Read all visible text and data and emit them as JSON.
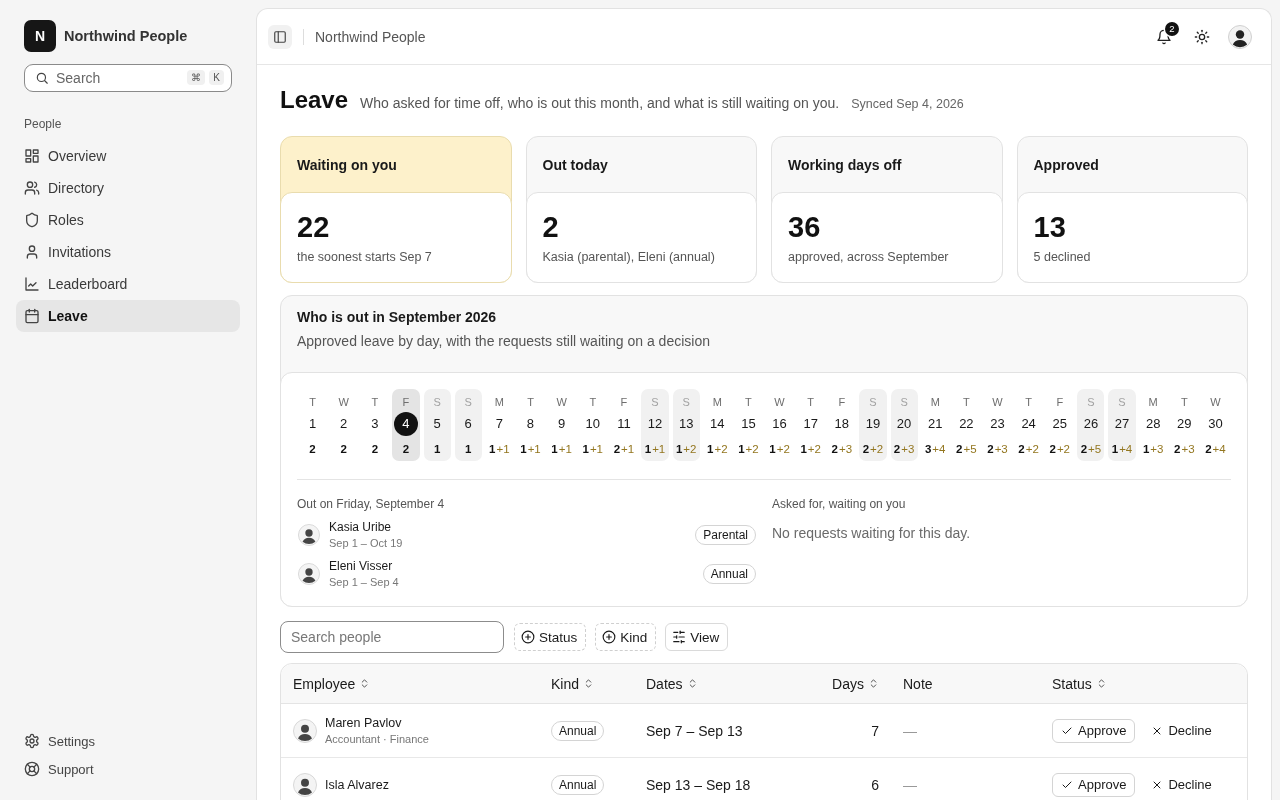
{
  "sidebar": {
    "brand": {
      "initial": "N",
      "name": "Northwind People"
    },
    "search": {
      "placeholder": "Search",
      "shortcut": [
        "⌘",
        "K"
      ]
    },
    "section": "People",
    "items": [
      {
        "label": "Overview",
        "selected": false
      },
      {
        "label": "Directory",
        "selected": false
      },
      {
        "label": "Roles",
        "selected": false
      },
      {
        "label": "Invitations",
        "selected": false
      },
      {
        "label": "Leaderboard",
        "selected": false
      },
      {
        "label": "Leave",
        "selected": true
      }
    ],
    "footer_items": [
      {
        "label": "Settings"
      },
      {
        "label": "Support"
      }
    ]
  },
  "header": {
    "breadcrumb": "Northwind People",
    "notification_count": "2"
  },
  "page": {
    "title": "Leave",
    "subtitle": "Who asked for time off, who is out this month, and what is still waiting on you.",
    "synced": "Synced Sep 4, 2026"
  },
  "stats": [
    {
      "title": "Waiting on you",
      "value": "22",
      "caption": "the soonest starts Sep 7",
      "highlight": true
    },
    {
      "title": "Out today",
      "value": "2",
      "caption": "Kasia (parental), Eleni (annual)",
      "highlight": false
    },
    {
      "title": "Working days off",
      "value": "36",
      "caption": "approved, across September",
      "highlight": false
    },
    {
      "title": "Approved",
      "value": "13",
      "caption": "5 declined",
      "highlight": false
    }
  ],
  "calendar": {
    "title": "Who is out in September 2026",
    "subtitle": "Approved leave by day, with the requests still waiting on a decision",
    "days": [
      {
        "weekday": "T",
        "date": "1",
        "out": "2",
        "weekend": false,
        "selected": false
      },
      {
        "weekday": "W",
        "date": "2",
        "out": "2",
        "weekend": false,
        "selected": false
      },
      {
        "weekday": "T",
        "date": "3",
        "out": "2",
        "weekend": false,
        "selected": false
      },
      {
        "weekday": "F",
        "date": "4",
        "out": "2",
        "weekend": false,
        "selected": true
      },
      {
        "weekday": "S",
        "date": "5",
        "out": "1",
        "weekend": true,
        "selected": false
      },
      {
        "weekday": "S",
        "date": "6",
        "out": "1",
        "weekend": true,
        "selected": false
      },
      {
        "weekday": "M",
        "date": "7",
        "out": "1",
        "waiting": "+1",
        "weekend": false,
        "selected": false
      },
      {
        "weekday": "T",
        "date": "8",
        "out": "1",
        "waiting": "+1",
        "weekend": false,
        "selected": false
      },
      {
        "weekday": "W",
        "date": "9",
        "out": "1",
        "waiting": "+1",
        "weekend": false,
        "selected": false
      },
      {
        "weekday": "T",
        "date": "10",
        "out": "1",
        "waiting": "+1",
        "weekend": false,
        "selected": false
      },
      {
        "weekday": "F",
        "date": "11",
        "out": "2",
        "waiting": "+1",
        "weekend": false,
        "selected": false
      },
      {
        "weekday": "S",
        "date": "12",
        "out": "1",
        "waiting": "+1",
        "weekend": true,
        "selected": false
      },
      {
        "weekday": "S",
        "date": "13",
        "out": "1",
        "waiting": "+2",
        "weekend": true,
        "selected": false
      },
      {
        "weekday": "M",
        "date": "14",
        "out": "1",
        "waiting": "+2",
        "weekend": false,
        "selected": false
      },
      {
        "weekday": "T",
        "date": "15",
        "out": "1",
        "waiting": "+2",
        "weekend": false,
        "selected": false
      },
      {
        "weekday": "W",
        "date": "16",
        "out": "1",
        "waiting": "+2",
        "weekend": false,
        "selected": false
      },
      {
        "weekday": "T",
        "date": "17",
        "out": "1",
        "waiting": "+2",
        "weekend": false,
        "selected": false
      },
      {
        "weekday": "F",
        "date": "18",
        "out": "2",
        "waiting": "+3",
        "weekend": false,
        "selected": false
      },
      {
        "weekday": "S",
        "date": "19",
        "out": "2",
        "waiting": "+2",
        "weekend": true,
        "selected": false
      },
      {
        "weekday": "S",
        "date": "20",
        "out": "2",
        "waiting": "+3",
        "weekend": true,
        "selected": false
      },
      {
        "weekday": "M",
        "date": "21",
        "out": "3",
        "waiting": "+4",
        "weekend": false,
        "selected": false
      },
      {
        "weekday": "T",
        "date": "22",
        "out": "2",
        "waiting": "+5",
        "weekend": false,
        "selected": false
      },
      {
        "weekday": "W",
        "date": "23",
        "out": "2",
        "waiting": "+3",
        "weekend": false,
        "selected": false
      },
      {
        "weekday": "T",
        "date": "24",
        "out": "2",
        "waiting": "+2",
        "weekend": false,
        "selected": false
      },
      {
        "weekday": "F",
        "date": "25",
        "out": "2",
        "waiting": "+2",
        "weekend": false,
        "selected": false
      },
      {
        "weekday": "S",
        "date": "26",
        "out": "2",
        "waiting": "+5",
        "weekend": true,
        "selected": false
      },
      {
        "weekday": "S",
        "date": "27",
        "out": "1",
        "waiting": "+4",
        "weekend": true,
        "selected": false
      },
      {
        "weekday": "M",
        "date": "28",
        "out": "1",
        "waiting": "+3",
        "weekend": false,
        "selected": false
      },
      {
        "weekday": "T",
        "date": "29",
        "out": "2",
        "waiting": "+3",
        "weekend": false,
        "selected": false
      },
      {
        "weekday": "W",
        "date": "30",
        "out": "2",
        "waiting": "+4",
        "weekend": false,
        "selected": false
      }
    ],
    "out_title": "Out on Friday, September 4",
    "out_people": [
      {
        "name": "Kasia Uribe",
        "dates": "Sep 1 – Oct 19",
        "leave_type": "Parental"
      },
      {
        "name": "Eleni Visser",
        "dates": "Sep 1 – Sep 4",
        "leave_type": "Annual"
      }
    ],
    "waiting_title": "Asked for, waiting on you",
    "waiting_empty": "No requests waiting for this day."
  },
  "filters": {
    "search_placeholder": "Search people",
    "buttons": [
      {
        "label": "Status",
        "kind": "filter"
      },
      {
        "label": "Kind",
        "kind": "filter"
      },
      {
        "label": "View",
        "kind": "view"
      }
    ]
  },
  "table": {
    "columns": [
      {
        "label": "Employee",
        "sortable": true
      },
      {
        "label": "Kind",
        "sortable": true
      },
      {
        "label": "Dates",
        "sortable": true
      },
      {
        "label": "Days",
        "sortable": true
      },
      {
        "label": "Note",
        "sortable": false
      },
      {
        "label": "Status",
        "sortable": true
      }
    ],
    "rows": [
      {
        "name": "Maren Pavlov",
        "role": "Accountant · Finance",
        "leave_type": "Annual",
        "dates": "Sep 7 – Sep 13",
        "days": "7",
        "note": "—",
        "actions": [
          {
            "label": "Approve",
            "kind": "approve"
          },
          {
            "label": "Decline",
            "kind": "decline"
          }
        ]
      },
      {
        "name": "Isla Alvarez",
        "leave_type": "Annual",
        "dates": "Sep 13 – Sep 18",
        "days": "6",
        "note": "—",
        "actions": [
          {
            "label": "Approve",
            "kind": "approve"
          },
          {
            "label": "Decline",
            "kind": "decline"
          }
        ]
      }
    ]
  }
}
